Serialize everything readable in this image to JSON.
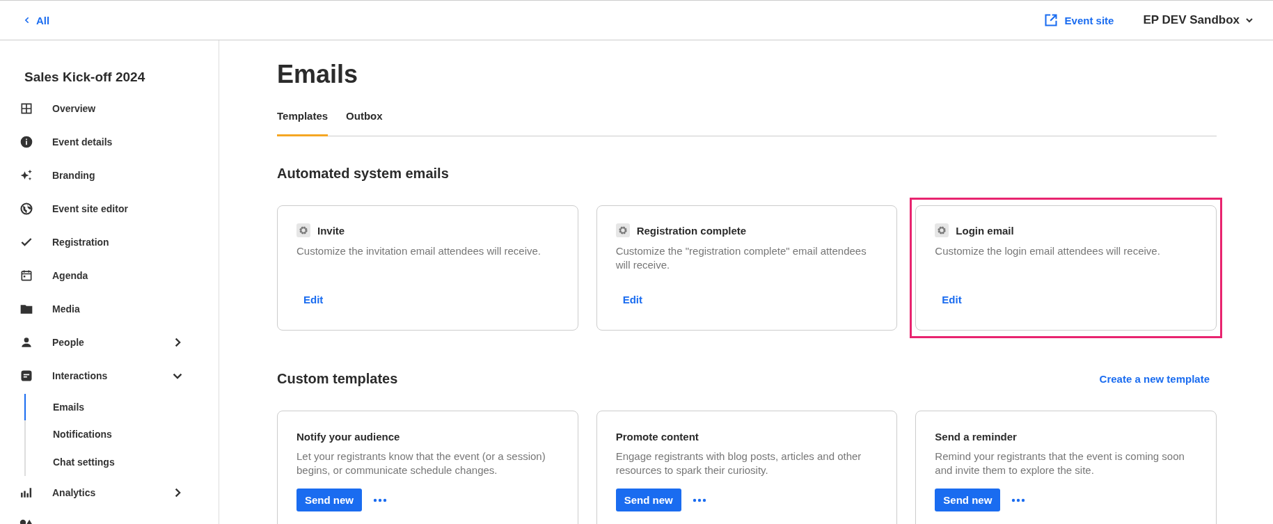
{
  "header": {
    "back_link": "All",
    "event_site_link": "Event site",
    "account_menu": "EP DEV Sandbox"
  },
  "sidebar": {
    "title": "Sales Kick-off 2024",
    "items": [
      {
        "label": "Overview"
      },
      {
        "label": "Event details"
      },
      {
        "label": "Branding"
      },
      {
        "label": "Event site editor"
      },
      {
        "label": "Registration"
      },
      {
        "label": "Agenda"
      },
      {
        "label": "Media"
      },
      {
        "label": "People",
        "expanded": false
      },
      {
        "label": "Interactions",
        "expanded": true,
        "children": [
          {
            "label": "Emails",
            "selected": true
          },
          {
            "label": "Notifications",
            "selected": false
          },
          {
            "label": "Chat settings",
            "selected": false
          }
        ]
      },
      {
        "label": "Analytics",
        "expanded": false
      }
    ],
    "cut_off_item_below": true
  },
  "main": {
    "title": "Emails",
    "tabs": [
      {
        "label": "Templates",
        "selected": true
      },
      {
        "label": "Outbox",
        "selected": false
      }
    ],
    "automated": {
      "heading": "Automated system emails",
      "cards": [
        {
          "title": "Invite",
          "description": "Customize the invitation email attendees will receive.",
          "action": "Edit",
          "highlighted": false
        },
        {
          "title": "Registration complete",
          "description": "Customize the \"registration complete\" email attendees will receive.",
          "action": "Edit",
          "highlighted": false
        },
        {
          "title": "Login email",
          "description": "Customize the login email attendees will receive.",
          "action": "Edit",
          "highlighted": true
        }
      ]
    },
    "custom": {
      "heading": "Custom templates",
      "create_link": "Create a new template",
      "cards": [
        {
          "title": "Notify your audience",
          "description": "Let your registrants know that the event (or a session) begins, or communicate schedule changes.",
          "action": "Send new"
        },
        {
          "title": "Promote content",
          "description": "Engage registrants with blog posts, articles and other resources to spark their curiosity.",
          "action": "Send new"
        },
        {
          "title": "Send a reminder",
          "description": "Remind your registrants that the event is coming soon and invite them to explore the site.",
          "action": "Send new"
        }
      ]
    }
  }
}
